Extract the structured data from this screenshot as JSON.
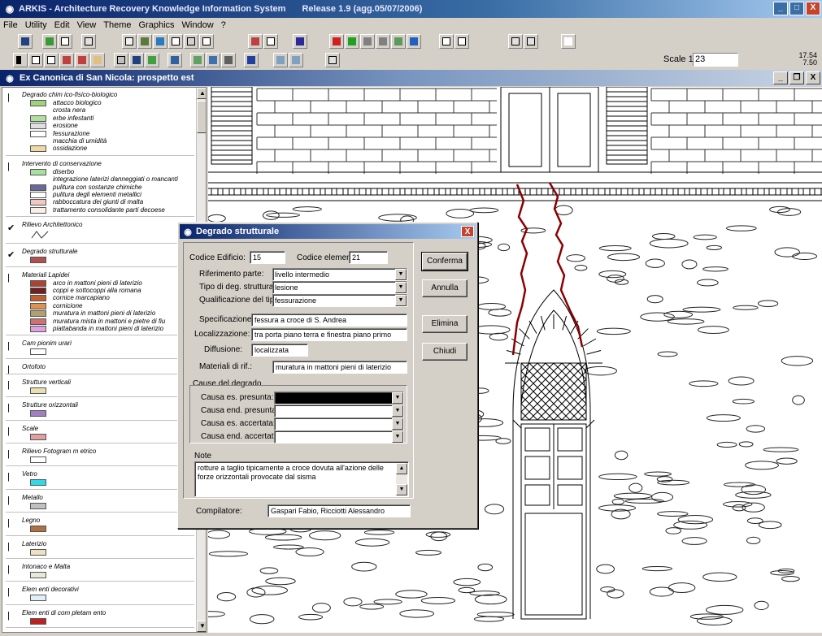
{
  "window": {
    "title": "ARKIS - Architecture Recovery Knowledge Information System",
    "release": "Release 1.9  (agg.05/07/2006)",
    "minimize": "_",
    "maximize": "□",
    "close": "X"
  },
  "menu": [
    "File",
    "Utility",
    "Edit",
    "View",
    "Theme",
    "Graphics",
    "Window",
    "?"
  ],
  "toolbar": {
    "scale_label": "Scale 1:",
    "scale_value": "23",
    "coord_x": "17.54",
    "coord_y": "7.50"
  },
  "child_window": {
    "title": "Ex Canonica di San Nicola: prospetto est",
    "minimize": "_",
    "restore": "❐",
    "close": "X"
  },
  "legend": {
    "groups": [
      {
        "title": "Degrado chim ico-fisico-biologico",
        "checked": false,
        "items": [
          {
            "label": "attacco biologico",
            "color": "#9fd27c"
          },
          {
            "label": "crosta nera",
            "color": ""
          },
          {
            "label": "erbe infestanti",
            "color": "#b0e0a0"
          },
          {
            "label": "erosione",
            "color": "#e0e0e0"
          },
          {
            "label": "fessurazione",
            "color": "#ffffff"
          },
          {
            "label": "macchia di umidità",
            "color": ""
          },
          {
            "label": "ossidazione",
            "color": "#f0d8a0"
          }
        ]
      },
      {
        "title": "Intervento di conservazione",
        "checked": false,
        "items": [
          {
            "label": "diserbo",
            "color": "#a8e0a0"
          },
          {
            "label": "integrazione laterizi danneggiati o mancanti",
            "color": ""
          },
          {
            "label": "pulitura con sostanze chimiche",
            "color": "#6a6a9a"
          },
          {
            "label": "pulitura degli elementi metallici",
            "color": "#ffffff"
          },
          {
            "label": "rabboccatura dei giunti di malta",
            "color": "#f0c8c0"
          },
          {
            "label": "trattamento consolidante parti decoese",
            "color": "#f8f0e8"
          }
        ]
      },
      {
        "title": "Rilievo Architettonico",
        "checked": true,
        "items": []
      },
      {
        "title": "Degrado strutturale",
        "checked": true,
        "items": [
          {
            "label": "",
            "color": "#b05050"
          }
        ]
      },
      {
        "title": "Materiali Lapidei",
        "checked": false,
        "items": [
          {
            "label": "arco in mattoni pieni di laterizio",
            "color": "#b04030"
          },
          {
            "label": "coppi e sottocoppi alla romana",
            "color": "#702020"
          },
          {
            "label": "cornice marcapiano",
            "color": "#c06030"
          },
          {
            "label": "cornicione",
            "color": "#e09050"
          },
          {
            "label": "muratura in mattoni pieni di laterizio",
            "color": "#b0a070"
          },
          {
            "label": "muratura mista in mattoni e pietre di fiu",
            "color": "#d07070"
          },
          {
            "label": "piattabanda in mattoni pieni di laterizio",
            "color": "#e0a0e0"
          }
        ]
      },
      {
        "title": "Cam pionim urari",
        "checked": false,
        "items": [
          {
            "label": "",
            "color": "#ffffff"
          }
        ]
      },
      {
        "title": "Ortofoto",
        "checked": false,
        "items": []
      },
      {
        "title": "Strutture verticali",
        "checked": false,
        "items": [
          {
            "label": "",
            "color": "#e8e0b0"
          }
        ]
      },
      {
        "title": "Strutture orizzontali",
        "checked": false,
        "items": [
          {
            "label": "",
            "color": "#a080c0"
          }
        ]
      },
      {
        "title": "Scale",
        "checked": false,
        "items": [
          {
            "label": "",
            "color": "#e0a0a0"
          }
        ]
      },
      {
        "title": "Rilievo Fotogram m etrico",
        "checked": false,
        "items": [
          {
            "label": "",
            "color": "#ffffff"
          }
        ]
      },
      {
        "title": "Vetro",
        "checked": false,
        "items": [
          {
            "label": "",
            "color": "#30d8e8"
          }
        ]
      },
      {
        "title": "Metallo",
        "checked": false,
        "items": [
          {
            "label": "",
            "color": "#c0c0c0"
          }
        ]
      },
      {
        "title": "Legno",
        "checked": false,
        "items": [
          {
            "label": "",
            "color": "#b07040"
          }
        ]
      },
      {
        "title": "Laterizio",
        "checked": false,
        "items": [
          {
            "label": "",
            "color": "#f0e0c0"
          }
        ]
      },
      {
        "title": "Intonaco e Malta",
        "checked": false,
        "items": [
          {
            "label": "",
            "color": "#e8e8d8"
          }
        ]
      },
      {
        "title": "Elem enti decorativi",
        "checked": false,
        "items": [
          {
            "label": "",
            "color": "#e0f0f8"
          }
        ]
      },
      {
        "title": "Elem enti di com pletam ento",
        "checked": false,
        "items": [
          {
            "label": "",
            "color": "#c02020"
          }
        ]
      }
    ]
  },
  "dialog": {
    "title": "Degrado strutturale",
    "close": "X",
    "codice_edificio_label": "Codice Edificio:",
    "codice_edificio": "15",
    "codice_elemento_label": "Codice elemento:",
    "codice_elemento": "21",
    "riferimento_label": "Riferimento parte:",
    "riferimento": "livello intermedio",
    "tipo_label": "Tipo di deg. strutturale:",
    "tipo": "lesione",
    "qualificazione_label": "Qualificazione del tipo:",
    "qualificazione": "fessurazione",
    "specificazione_label": "Specificazione:",
    "specificazione": "fessura a croce di S. Andrea",
    "localizzazione_label": "Localizzazione:",
    "localizzazione": "tra porta piano terra e finestra piano primo",
    "diffusione_label": "Diffusione:",
    "diffusione": "localizzata",
    "materiali_label": "Materiali di rif.:",
    "materiali": "muratura in mattoni pieni di laterizio",
    "cause_label": "Cause del degrado",
    "causa_es_presunta_label": "Causa es. presunta:",
    "causa_es_presunta": "",
    "causa_end_presunta_label": "Causa end. presunta:",
    "causa_end_presunta": "",
    "causa_es_accertata_label": "Causa es. accertata:",
    "causa_es_accertata": "",
    "causa_end_accertata_label": "Causa end. accertata:",
    "causa_end_accertata": "",
    "note_label": "Note",
    "note": "rotture a taglio tipicamente a croce dovuta all'azione delle forze orizzontali provocate dal sisma",
    "compilatore_label": "Compilatore:",
    "compilatore": "Gaspari Fabio, Ricciotti Alessandro",
    "buttons": {
      "conferma": "Conferma",
      "annulla": "Annulla",
      "elimina": "Elimina",
      "chiudi": "Chiudi"
    }
  }
}
